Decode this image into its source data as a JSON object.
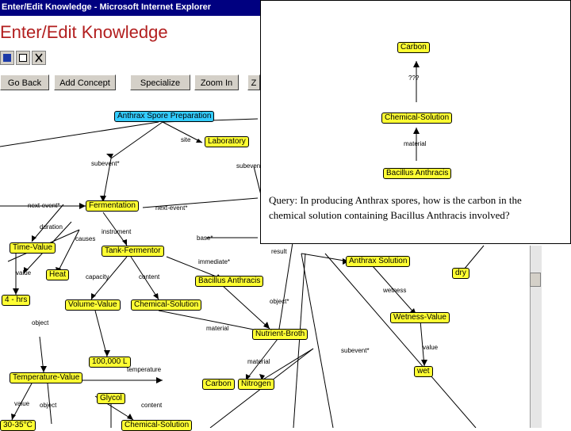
{
  "window": {
    "title": "Enter/Edit Knowledge - Microsoft Internet Explorer"
  },
  "page": {
    "heading": "Enter/Edit Knowledge"
  },
  "toolbar": {
    "icons": [
      "save-icon",
      "edit-icon",
      "cut-icon"
    ],
    "buttons": [
      "Go Back",
      "Add Concept",
      "Specialize",
      "Zoom In",
      "Z"
    ]
  },
  "main_graph": {
    "nodes": {
      "spore_prep": "Anthrax Spore Preparation",
      "laboratory": "Laboratory",
      "fermentation": "Fermentation",
      "time_value": "Time-Value",
      "tank_fermentor": "Tank-Fermentor",
      "heat": "Heat",
      "bacillus_anthracis": "Bacillus Anthracis",
      "val_4": "4 - hrs",
      "volume_value": "Volume-Value",
      "chemical_solution": "Chemical-Solution",
      "nutrient_broth": "Nutrient-Broth",
      "anthrax_solution": "Anthrax Solution",
      "dry": "dry",
      "wetness_value": "Wetness-Value",
      "wet": "wet",
      "val_100000": "100,000 L",
      "temperature_value": "Temperature-Value",
      "glycol": "Glycol",
      "carbon": "Carbon",
      "nitrogen": "Nitrogen",
      "val_temp": "30-35°C",
      "chemical_bottom": "Chemical-Solution"
    },
    "edge_labels": {
      "site": "site",
      "subevent1": "subevent*",
      "next_event": "next-event*",
      "duration": "duration",
      "instrument": "instrument",
      "next_event2": "next-event*",
      "base": "base*",
      "object1": "object",
      "causes": "causes",
      "value1": "value",
      "capacity": "capacity",
      "content1": "content",
      "immediate": "immediate*",
      "material1": "material",
      "object2": "object*",
      "result": "result",
      "wetness": "wetness",
      "value2": "value",
      "subevent2": "subevent*",
      "material2": "material",
      "temperature": "temperature",
      "value3": "value",
      "object3": "object",
      "content2": "content",
      "subevent_top": "subevent*"
    }
  },
  "query_panel": {
    "nodes": {
      "carbon": "Carbon",
      "chemical_solution": "Chemical-Solution",
      "bacillus_anthracis": "Bacillus Anthracis"
    },
    "edge_labels": {
      "unknown": "???",
      "material": "material"
    },
    "query": "Query: In producing Anthrax spores, how is the carbon in the chemical solution containing Bacillus Anthracis involved?"
  },
  "colors": {
    "node": "#ffff33",
    "root_node": "#33ccff",
    "title_bar": "#000080",
    "heading": "#b21e1e"
  }
}
